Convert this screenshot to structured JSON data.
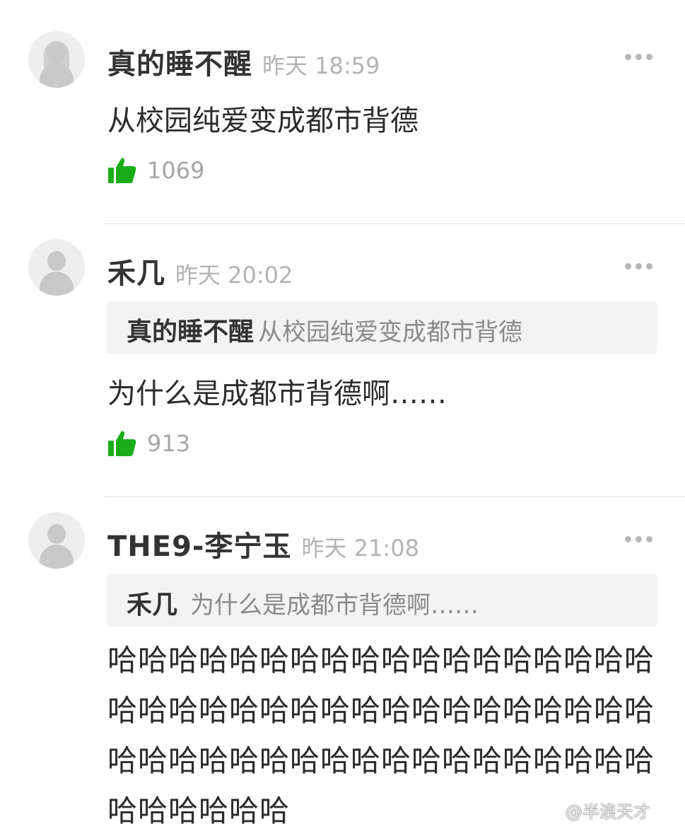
{
  "comments": [
    {
      "username": "真的睡不醒",
      "time": "昨天 18:59",
      "quote": null,
      "content": "从校园纯爱变成都市背德",
      "likes": "1069"
    },
    {
      "username": "禾几",
      "time": "昨天 20:02",
      "quote": {
        "user": "真的睡不醒",
        "text": "从校园纯爱变成都市背德"
      },
      "content": "为什么是成都市背德啊……",
      "likes": "913"
    },
    {
      "username": "THE9-李宁玉",
      "time": "昨天 21:08",
      "quote": {
        "user": "禾几",
        "text": "为什么是成都市背德啊……"
      },
      "content": "哈哈哈哈哈哈哈哈哈哈哈哈哈哈哈哈哈哈哈哈哈哈哈哈哈哈哈哈哈哈哈哈哈哈哈哈哈哈哈哈哈哈哈哈哈哈哈哈哈哈哈哈哈哈哈哈哈哈哈哈"
    }
  ],
  "icons": {
    "like": "thumbs-up-icon",
    "more": "more-dots-icon",
    "avatar": "default-avatar-icon"
  },
  "colors": {
    "like_green": "#1aad19",
    "quote_bg": "#f3f3f3"
  },
  "watermark": "@半浪天才"
}
